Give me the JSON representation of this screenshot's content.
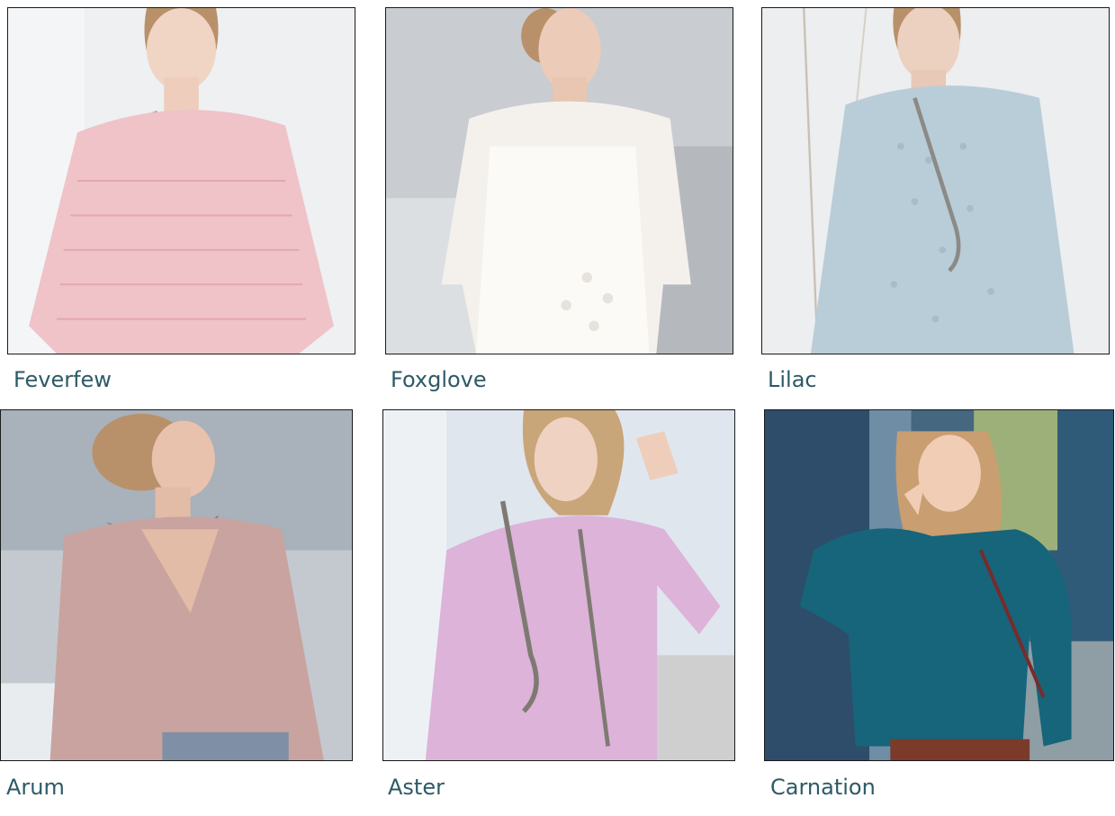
{
  "products": [
    {
      "name": "Feverfew",
      "sweater_color": "#efc3c8",
      "backdrop_color": "#eef0f2"
    },
    {
      "name": "Foxglove",
      "sweater_color": "#f4f1ec",
      "backdrop_color": "#c9ccd0"
    },
    {
      "name": "Lilac",
      "sweater_color": "#b9cdd8",
      "backdrop_color": "#eceeef"
    },
    {
      "name": "Arum",
      "sweater_color": "#c9a39f",
      "backdrop_color": "#a9b1ba"
    },
    {
      "name": "Aster",
      "sweater_color": "#ddb3d9",
      "backdrop_color": "#dfe6ee"
    },
    {
      "name": "Carnation",
      "sweater_color": "#16657a",
      "backdrop_color": "#45677f"
    }
  ]
}
